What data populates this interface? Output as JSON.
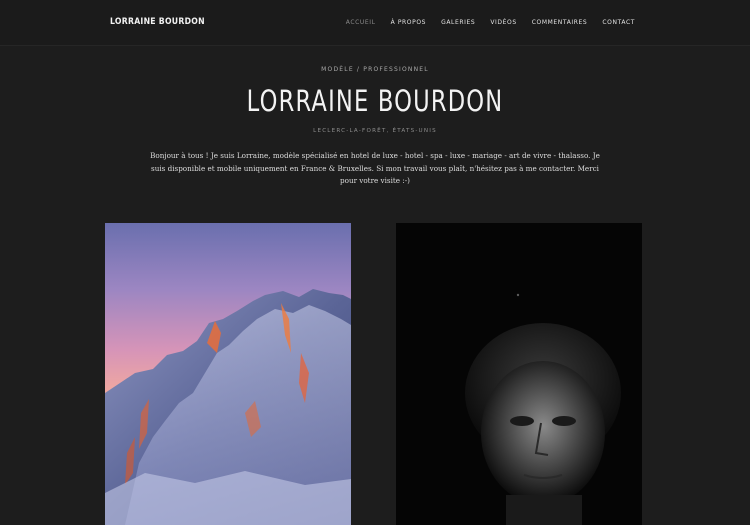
{
  "header": {
    "brand": "LORRAINE BOURDON",
    "nav": [
      {
        "label": "ACCUEIL",
        "active": true
      },
      {
        "label": "À PROPOS",
        "active": false
      },
      {
        "label": "GALERIES",
        "active": false
      },
      {
        "label": "VIDÉOS",
        "active": false
      },
      {
        "label": "COMMENTAIRES",
        "active": false
      },
      {
        "label": "CONTACT",
        "active": false
      }
    ]
  },
  "hero": {
    "eyebrow": "MODÈLE / PROFESSIONNEL",
    "title": "LORRAINE BOURDON",
    "location": "LECLERC-LA-FORÊT, ÉTATS-UNIS",
    "bio": "Bonjour à tous ! Je suis Lorraine, modèle spécialisé en hotel de luxe - hotel - spa - luxe - mariage - art de vivre - thalasso. Je suis disponible et mobile uniquement en France & Bruxelles. Si mon travail vous plaît, n'hésitez pas à me contacter. Merci pour votre visite :-)"
  },
  "gallery": [
    {
      "name": "mountain-sunset-photo"
    },
    {
      "name": "dark-portrait-photo"
    }
  ],
  "colors": {
    "background": "#1d1d1d",
    "nav_active": "#8a8a8a",
    "text": "#e8e8e8"
  }
}
